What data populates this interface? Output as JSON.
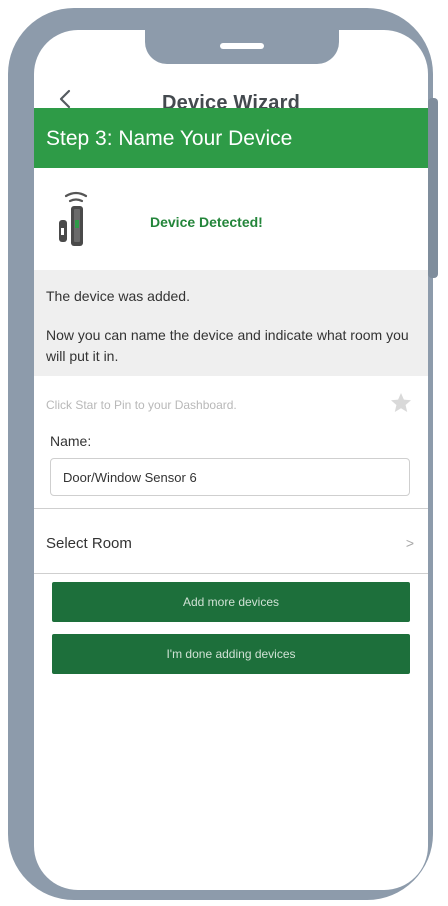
{
  "colors": {
    "frame": "#8d9bab",
    "step_bar": "#2e9b47",
    "button": "#1d6f3b",
    "detected_text": "#23853a"
  },
  "header": {
    "title": "Device Wizard",
    "back_icon": "chevron-left-icon"
  },
  "step": {
    "title": "Step 3: Name Your Device"
  },
  "device": {
    "icon": "door-window-sensor-icon",
    "status": "Device Detected!"
  },
  "info": {
    "line1": "The device was added.",
    "line2": "Now you can name the device and indicate what room you will put it in."
  },
  "pin": {
    "text": "Click Star to Pin to your Dashboard.",
    "icon": "star-icon"
  },
  "name_field": {
    "label": "Name:",
    "value": "Door/Window Sensor 6"
  },
  "room": {
    "label": "Select Room",
    "chevron": ">"
  },
  "buttons": {
    "add_more": "Add more devices",
    "done": "I'm done adding devices"
  }
}
